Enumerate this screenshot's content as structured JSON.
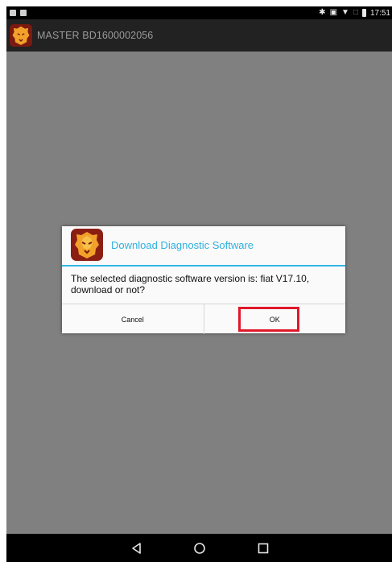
{
  "status_bar": {
    "time": "17:51",
    "left_icons": [
      "image-icon",
      "sd-card-icon"
    ],
    "right_icons": [
      "bluetooth-icon",
      "vibrate-icon",
      "wifi-icon",
      "no-sim-icon",
      "battery-icon"
    ]
  },
  "app_bar": {
    "title": "MASTER BD1600002056",
    "logo_icon": "lion-logo-icon"
  },
  "dialog": {
    "title": "Download Diagnostic Software",
    "message": "The selected diagnostic software version is: fiat V17.10, download or not?",
    "cancel_label": "Cancel",
    "ok_label": "OK",
    "accent_color": "#33b5e5",
    "highlight_color": "#e0182a"
  },
  "nav_bar": {
    "icons": [
      "back-icon",
      "home-icon",
      "recents-icon"
    ]
  },
  "colors": {
    "scrim": "#808080",
    "app_bar": "#222222",
    "logo_background": "#8b1e12",
    "logo_face": "#f2a12a"
  }
}
